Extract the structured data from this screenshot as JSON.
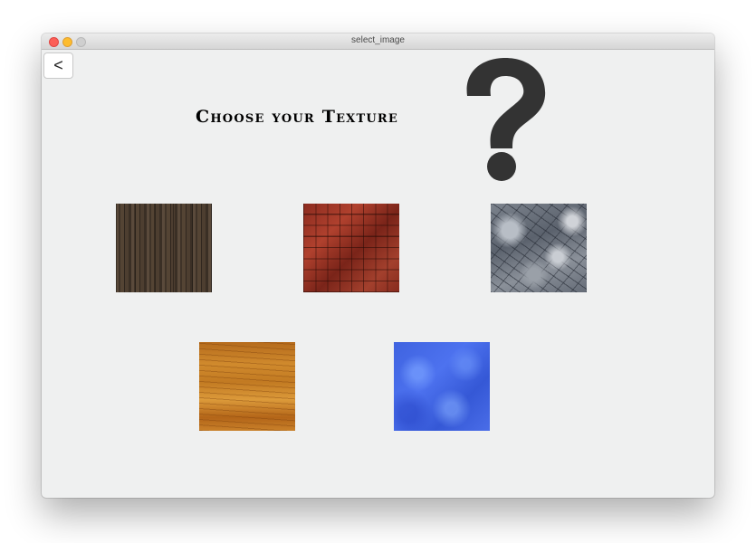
{
  "window": {
    "title": "select_image",
    "controls": [
      "close",
      "minimize",
      "zoom"
    ]
  },
  "toolbar": {
    "back_label": "<"
  },
  "heading": "Choose your Texture",
  "decoration": {
    "icon": "question-mark-icon",
    "color": "#333333"
  },
  "textures": [
    {
      "name": "dark-wood",
      "icon": "dark-wood-planks"
    },
    {
      "name": "red-brick",
      "icon": "red-brick-pattern"
    },
    {
      "name": "stone",
      "icon": "grey-stone-rock"
    },
    {
      "name": "light-wood",
      "icon": "light-wood-grain"
    },
    {
      "name": "blue-marble",
      "icon": "blue-marble"
    }
  ],
  "colors": {
    "window_bg": "#eff0f0",
    "heading": "#000000"
  }
}
